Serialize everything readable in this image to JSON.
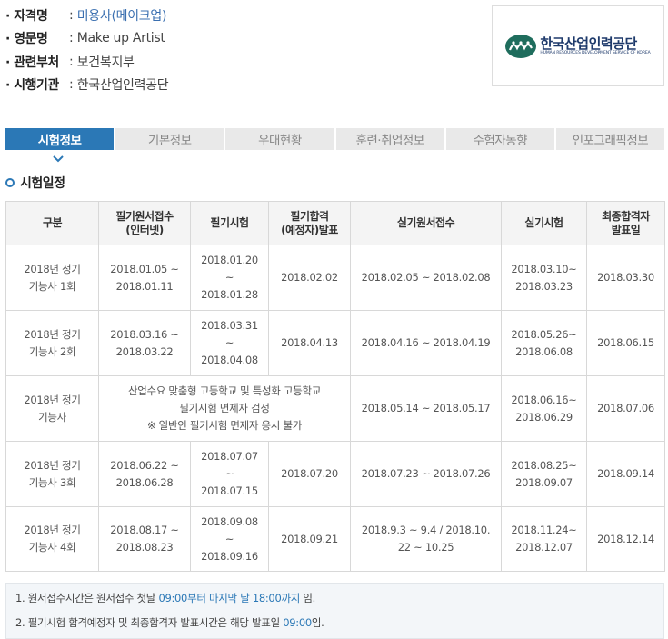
{
  "info": {
    "rows": [
      {
        "key": "자격명",
        "sep": ":",
        "value": "미용사(메이크업)"
      },
      {
        "key": "영문명",
        "sep": ":",
        "value": "Make up Artist"
      },
      {
        "key": "관련부처",
        "sep": ":",
        "value": "보건복지부"
      },
      {
        "key": "시행기관",
        "sep": ":",
        "value": "한국산업인력공단"
      }
    ]
  },
  "logo": {
    "name_ko": "한국산업인력공단",
    "name_en": "HUMAN RESOURCES DEVELOPMENT SERVICE OF KOREA"
  },
  "tabs": [
    "시험정보",
    "기본정보",
    "우대현황",
    "훈련·취업정보",
    "수험자동향",
    "인포그래픽정보"
  ],
  "active_tab": "시험정보",
  "section_title": "시험일정",
  "table": {
    "headers": [
      "구분",
      "필기원서접수\n(인터넷)",
      "필기시험",
      "필기합격\n(예정자)발표",
      "실기원서접수",
      "실기시험",
      "최종합격자\n발표일"
    ],
    "rows": [
      {
        "c0": "2018년 정기\n기능사 1회",
        "c1": "2018.01.05 ~\n2018.01.11",
        "c2": "2018.01.20\n~\n2018.01.28",
        "c3": "2018.02.02",
        "c4": "2018.02.05 ~ 2018.02.08",
        "c5": "2018.03.10~\n2018.03.23",
        "c6": "2018.03.30"
      },
      {
        "c0": "2018년 정기\n기능사 2회",
        "c1": "2018.03.16 ~\n2018.03.22",
        "c2": "2018.03.31\n~\n2018.04.08",
        "c3": "2018.04.13",
        "c4": "2018.04.16 ~ 2018.04.19",
        "c5": "2018.05.26~\n2018.06.08",
        "c6": "2018.06.15"
      },
      {
        "c0": "2018년 정기\n기능사",
        "merged": "산업수요 맞춤형 고등학교 및 특성화 고등학교\n필기시험 면제자 검정\n※ 일반인 필기시험 면제자 응시 불가",
        "c4": "2018.05.14 ~ 2018.05.17",
        "c5": "2018.06.16~\n2018.06.29",
        "c6": "2018.07.06"
      },
      {
        "c0": "2018년 정기\n기능사 3회",
        "c1": "2018.06.22 ~\n2018.06.28",
        "c2": "2018.07.07\n~\n2018.07.15",
        "c3": "2018.07.20",
        "c4": "2018.07.23 ~ 2018.07.26",
        "c5": "2018.08.25~\n2018.09.07",
        "c6": "2018.09.14"
      },
      {
        "c0": "2018년 정기\n기능사 4회",
        "c1": "2018.08.17 ~\n2018.08.23",
        "c2": "2018.09.08\n~\n2018.09.16",
        "c3": "2018.09.21",
        "c4": "2018.9.3 ~ 9.4 / 2018.10.\n22 ~ 10.25",
        "c5": "2018.11.24~\n2018.12.07",
        "c6": "2018.12.14"
      }
    ]
  },
  "notes": [
    {
      "pre": "1. 원서접수시간은 원서접수 첫날 ",
      "hl": "09:00부터 마지막 날 18:00까지",
      "post": " 임."
    },
    {
      "pre": "2. 필기시험 합격예정자 및 최종합격자 발표시간은 해당 발표일 ",
      "hl": "09:00",
      "post": "임."
    }
  ],
  "colors": {
    "accent": "#2b78b6",
    "tab_inactive": "#e9e9e9",
    "header_bg": "#f4f4f4",
    "note_bg": "#f3f6f9"
  }
}
